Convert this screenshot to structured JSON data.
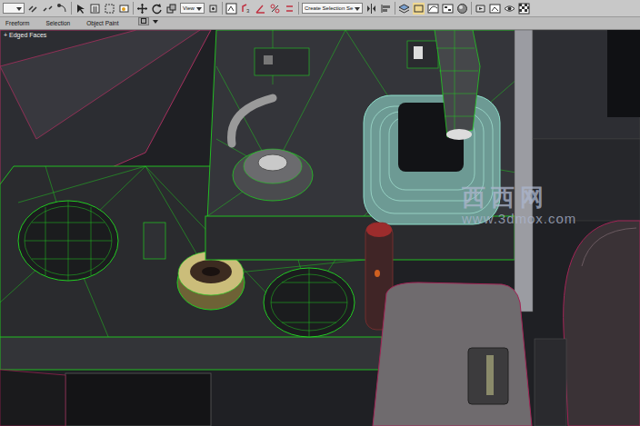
{
  "toolbar": {
    "view_dropdown": "View",
    "selection_set": "Create Selection Se"
  },
  "ribbon": {
    "tabs": [
      {
        "label": "Freeform",
        "selected": false
      },
      {
        "label": "Selection",
        "selected": false
      },
      {
        "label": "Object Paint",
        "selected": false
      }
    ]
  },
  "viewport": {
    "label": "+ Edged Faces"
  },
  "watermark": {
    "title": "西西网",
    "url": "www.3dmox.com"
  }
}
